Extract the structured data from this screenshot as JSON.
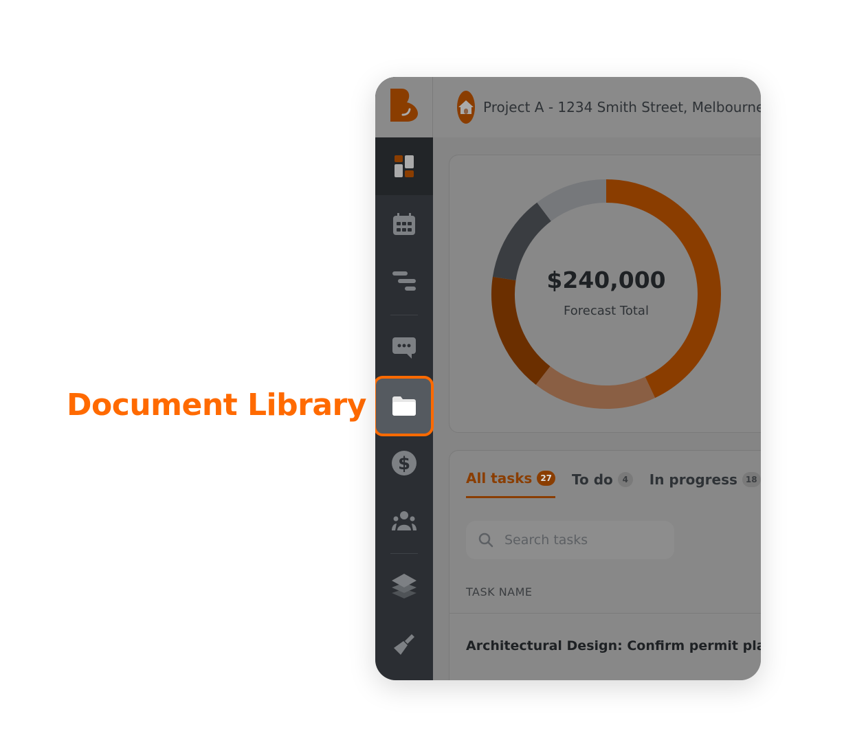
{
  "callout": {
    "label": "Document Library",
    "color": "#ff6a00"
  },
  "header": {
    "title": "Project A - 1234 Smith Street, Melbourne"
  },
  "sidebar": {
    "items": [
      {
        "icon": "dashboard-icon",
        "active": true
      },
      {
        "icon": "calendar-icon"
      },
      {
        "icon": "gantt-icon"
      },
      {
        "icon": "chat-icon"
      },
      {
        "icon": "folder-icon",
        "highlighted": true,
        "label": "Document Library"
      },
      {
        "icon": "dollar-icon"
      },
      {
        "icon": "team-icon"
      },
      {
        "icon": "layers-icon"
      },
      {
        "icon": "paintbrush-icon"
      }
    ]
  },
  "forecast": {
    "amount": "$240,000",
    "label": "Forecast Total",
    "segments": [
      {
        "percent": 43,
        "color": "#8a3d00"
      },
      {
        "percent": 17.5,
        "color": "#8a5f44"
      },
      {
        "percent": 16.9,
        "color": "#6b2f00"
      },
      {
        "percent": 12.3,
        "color": "#3a3d41"
      },
      {
        "percent": 10.3,
        "color": "#76787b"
      }
    ]
  },
  "tasks": {
    "tabs": [
      {
        "label": "All tasks",
        "count": "27"
      },
      {
        "label": "To do",
        "count": "4"
      },
      {
        "label": "In progress",
        "count": "18"
      }
    ],
    "search_placeholder": "Search tasks",
    "column": "TASK NAME",
    "rows": [
      "Architectural Design: Confirm permit plans"
    ]
  }
}
